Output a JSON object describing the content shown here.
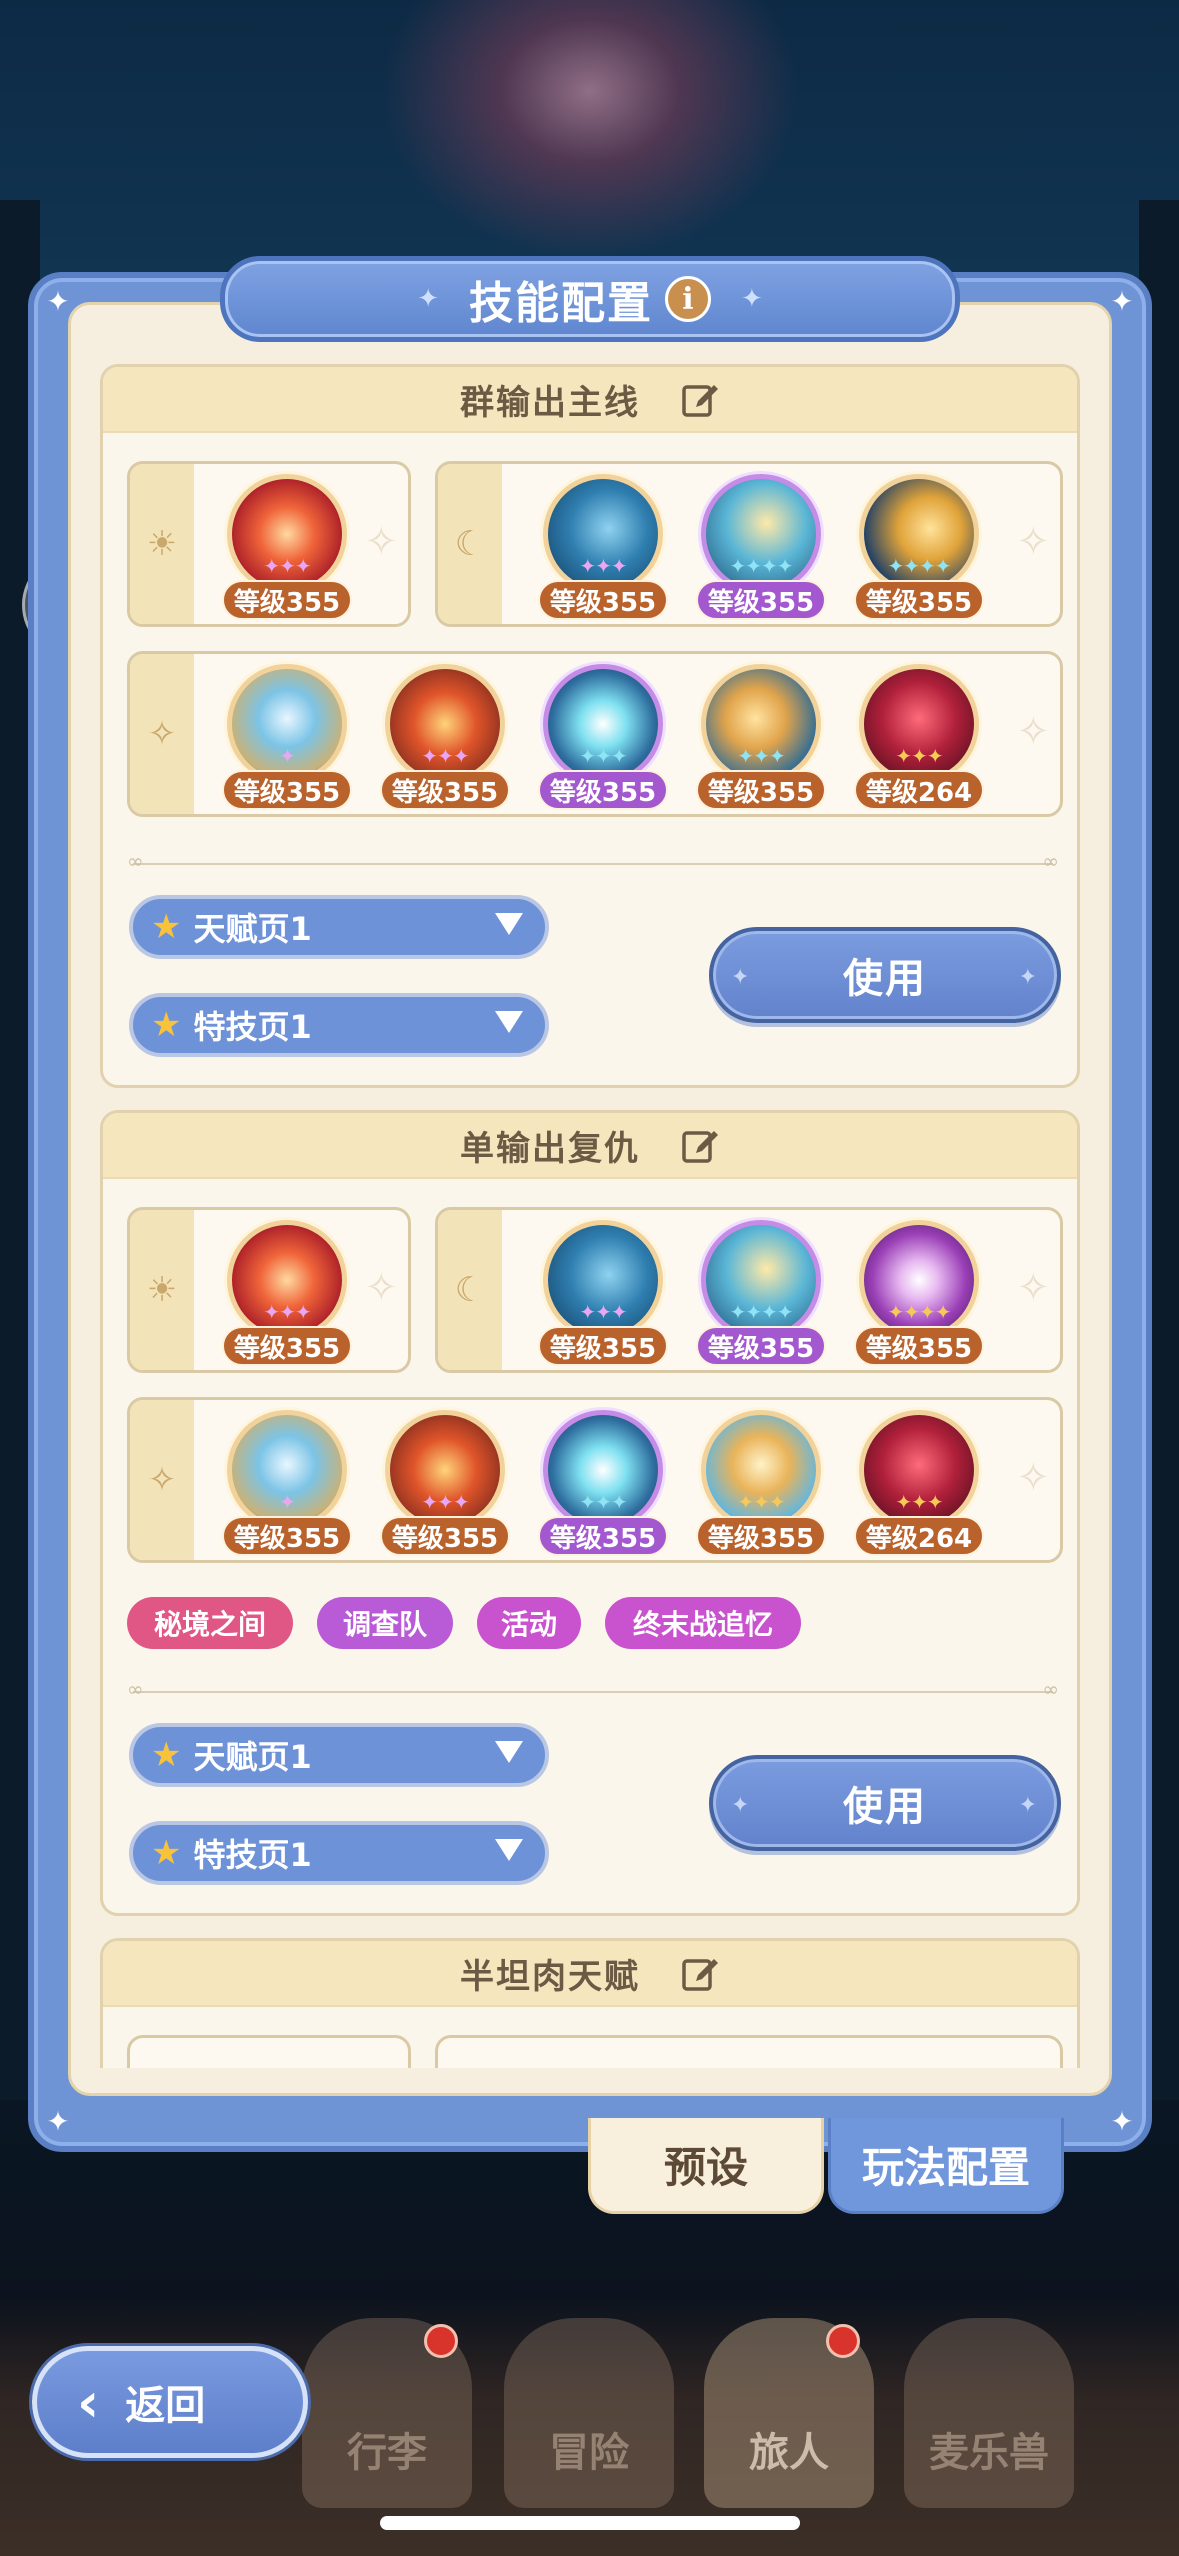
{
  "title": "技能配置",
  "info_icon": "i",
  "presets": [
    {
      "name": "群输出主线",
      "row1_left": [
        {
          "level": "等级355",
          "color": "orange"
        }
      ],
      "row1_right": [
        {
          "level": "等级355",
          "color": "orange"
        },
        {
          "level": "等级355",
          "color": "purple"
        },
        {
          "level": "等级355",
          "color": "orange"
        }
      ],
      "row2": [
        {
          "level": "等级355",
          "color": "orange"
        },
        {
          "level": "等级355",
          "color": "orange"
        },
        {
          "level": "等级355",
          "color": "purple"
        },
        {
          "level": "等级355",
          "color": "orange"
        },
        {
          "level": "等级264",
          "color": "orange"
        }
      ],
      "talent_page": "天赋页1",
      "special_page": "特技页1",
      "use_label": "使用"
    },
    {
      "name": "单输出复仇",
      "row1_left": [
        {
          "level": "等级355",
          "color": "orange"
        }
      ],
      "row1_right": [
        {
          "level": "等级355",
          "color": "orange"
        },
        {
          "level": "等级355",
          "color": "purple"
        },
        {
          "level": "等级355",
          "color": "orange"
        }
      ],
      "row2": [
        {
          "level": "等级355",
          "color": "orange"
        },
        {
          "level": "等级355",
          "color": "orange"
        },
        {
          "level": "等级355",
          "color": "purple"
        },
        {
          "level": "等级355",
          "color": "orange"
        },
        {
          "level": "等级264",
          "color": "orange"
        }
      ],
      "tags": [
        "秘境之间",
        "调查队",
        "活动",
        "终末战追忆"
      ],
      "talent_page": "天赋页1",
      "special_page": "特技页1",
      "use_label": "使用"
    },
    {
      "name": "半坦肉天赋"
    }
  ],
  "tabs": {
    "preset": "预设",
    "config": "玩法配置"
  },
  "nav": {
    "back": "返回",
    "items": [
      "行李",
      "冒险",
      "旅人",
      "麦乐兽"
    ]
  },
  "colors": {
    "accent": "#6e92d8",
    "level_orange": "#b9622b",
    "level_purple": "#a358cf",
    "tag_pink": "#e05785",
    "tag_purple": "#b95ad6"
  }
}
